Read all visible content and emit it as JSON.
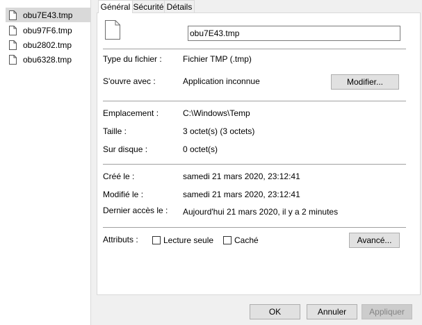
{
  "explorer": {
    "files": [
      {
        "name": "obu7E43.tmp",
        "selected": true
      },
      {
        "name": "obu97F6.tmp",
        "selected": false
      },
      {
        "name": "obu2802.tmp",
        "selected": false
      },
      {
        "name": "obu6328.tmp",
        "selected": false
      }
    ],
    "icon": "file-icon"
  },
  "dialog": {
    "tabs": [
      {
        "label": "Général",
        "active": true
      },
      {
        "label": "Sécurité",
        "active": false
      },
      {
        "label": "Détails",
        "active": false
      }
    ],
    "file_name_value": "obu7E43.tmp",
    "type_label": "Type du fichier :",
    "type_value": "Fichier TMP (.tmp)",
    "opens_with_label": "S'ouvre avec :",
    "opens_with_value": "Application inconnue",
    "modify_button": "Modifier...",
    "location_label": "Emplacement :",
    "location_value": "C:\\Windows\\Temp",
    "size_label": "Taille :",
    "size_value": "3 octet(s) (3 octets)",
    "disk_size_label": "Sur disque :",
    "disk_size_value": "0 octet(s)",
    "created_label": "Créé le :",
    "created_value": "samedi 21 mars 2020, 23:12:41",
    "modified_label": "Modifié le :",
    "modified_value": "samedi 21 mars 2020, 23:12:41",
    "accessed_label": "Dernier accès le :",
    "accessed_value": "Aujourd'hui 21 mars 2020, il y a 2 minutes",
    "attributes_label": "Attributs :",
    "readonly_label": "Lecture seule",
    "readonly_checked": false,
    "hidden_label": "Caché",
    "hidden_checked": false,
    "advanced_button": "Avancé...",
    "ok_button": "OK",
    "cancel_button": "Annuler",
    "apply_button": "Appliquer"
  }
}
